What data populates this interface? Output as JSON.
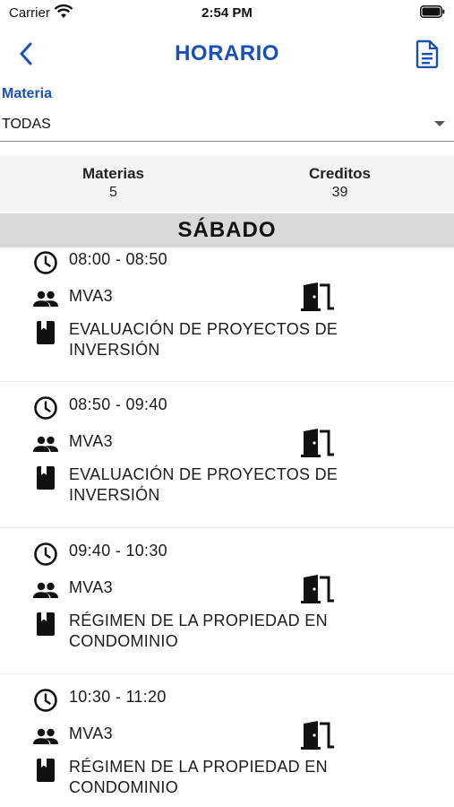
{
  "status_bar": {
    "carrier": "Carrier",
    "time": "2:54 PM"
  },
  "nav": {
    "title": "HORARIO"
  },
  "filter": {
    "label": "Materia",
    "value": "TODAS"
  },
  "summary": {
    "materias_label": "Materias",
    "materias_value": "5",
    "creditos_label": "Creditos",
    "creditos_value": "39"
  },
  "day": {
    "title": "SÁBADO"
  },
  "classes": [
    {
      "time": "08:00 - 08:50",
      "group": "MVA3",
      "subject": "EVALUACIÓN DE PROYECTOS DE INVERSIÓN"
    },
    {
      "time": "08:50 - 09:40",
      "group": "MVA3",
      "subject": "EVALUACIÓN DE PROYECTOS DE INVERSIÓN"
    },
    {
      "time": "09:40 - 10:30",
      "group": "MVA3",
      "subject": "RÉGIMEN DE LA PROPIEDAD EN CONDOMINIO"
    },
    {
      "time": "10:30 - 11:20",
      "group": "MVA3",
      "subject": "RÉGIMEN DE LA PROPIEDAD EN CONDOMINIO"
    }
  ],
  "colors": {
    "accent": "#1a4fba",
    "summary_bg": "#f4f4f4",
    "day_header_bg": "#d9d9d9"
  },
  "icons": [
    "wifi-icon",
    "battery-icon",
    "back-chevron-icon",
    "document-icon",
    "clock-icon",
    "group-icon",
    "book-icon",
    "door-icon",
    "dropdown-caret-icon"
  ]
}
